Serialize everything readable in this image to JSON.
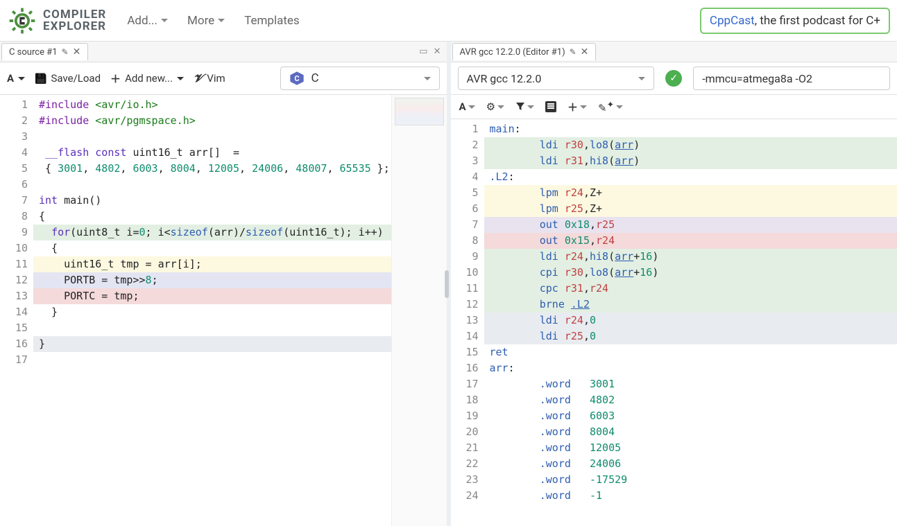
{
  "brand": {
    "line1": "COMPILER",
    "line2": "EXPLORER"
  },
  "topmenu": {
    "add": "Add...",
    "more": "More",
    "templates": "Templates"
  },
  "sponsor": {
    "link_text": "CppCast",
    "rest": ", the first podcast for C+"
  },
  "left": {
    "tab": {
      "title": "C source #1"
    },
    "toolbar": {
      "save": "Save/Load",
      "addnew": "Add new...",
      "vim": "Vim"
    },
    "language": "C",
    "code": [
      {
        "n": 1,
        "hl": "none",
        "tokens": [
          [
            "pre",
            "#include"
          ],
          [
            "id",
            " "
          ],
          [
            "str",
            "<avr/io.h>"
          ]
        ]
      },
      {
        "n": 2,
        "hl": "none",
        "tokens": [
          [
            "pre",
            "#include"
          ],
          [
            "id",
            " "
          ],
          [
            "str",
            "<avr/pgmspace.h>"
          ]
        ]
      },
      {
        "n": 3,
        "hl": "none",
        "tokens": []
      },
      {
        "n": 4,
        "hl": "none",
        "tokens": [
          [
            "id",
            " "
          ],
          [
            "kw",
            "__flash"
          ],
          [
            "id",
            " "
          ],
          [
            "kw",
            "const"
          ],
          [
            "id",
            " uint16_t arr[]  ="
          ]
        ]
      },
      {
        "n": 5,
        "hl": "none",
        "tokens": [
          [
            "id",
            " { "
          ],
          [
            "num",
            "3001"
          ],
          [
            "id",
            ", "
          ],
          [
            "num",
            "4802"
          ],
          [
            "id",
            ", "
          ],
          [
            "num",
            "6003"
          ],
          [
            "id",
            ", "
          ],
          [
            "num",
            "8004"
          ],
          [
            "id",
            ", "
          ],
          [
            "num",
            "12005"
          ],
          [
            "id",
            ", "
          ],
          [
            "num",
            "24006"
          ],
          [
            "id",
            ", "
          ],
          [
            "num",
            "48007"
          ],
          [
            "id",
            ", "
          ],
          [
            "num",
            "65535"
          ],
          [
            "id",
            " };"
          ]
        ]
      },
      {
        "n": 6,
        "hl": "none",
        "tokens": []
      },
      {
        "n": 7,
        "hl": "none",
        "tokens": [
          [
            "kw",
            "int"
          ],
          [
            "id",
            " main()"
          ]
        ]
      },
      {
        "n": 8,
        "hl": "none",
        "tokens": [
          [
            "id",
            "{"
          ]
        ]
      },
      {
        "n": 9,
        "hl": "green",
        "tokens": [
          [
            "id",
            "  "
          ],
          [
            "kw",
            "for"
          ],
          [
            "id",
            "(uint8_t i="
          ],
          [
            "num",
            "0"
          ],
          [
            "id",
            "; i<"
          ],
          [
            "kw2",
            "sizeof"
          ],
          [
            "id",
            "(arr)/"
          ],
          [
            "kw2",
            "sizeof"
          ],
          [
            "id",
            "(uint16_t); i++)"
          ]
        ]
      },
      {
        "n": 10,
        "hl": "none",
        "tokens": [
          [
            "id",
            "  {"
          ]
        ]
      },
      {
        "n": 11,
        "hl": "yellow",
        "tokens": [
          [
            "id",
            "    uint16_t tmp = arr[i];"
          ]
        ]
      },
      {
        "n": 12,
        "hl": "blue",
        "tokens": [
          [
            "id",
            "    PORTB = tmp>>"
          ],
          [
            "num",
            "8"
          ],
          [
            "id",
            ";"
          ]
        ]
      },
      {
        "n": 13,
        "hl": "red",
        "tokens": [
          [
            "id",
            "    PORTC = tmp;"
          ]
        ]
      },
      {
        "n": 14,
        "hl": "none",
        "tokens": [
          [
            "id",
            "  }"
          ]
        ]
      },
      {
        "n": 15,
        "hl": "none",
        "tokens": []
      },
      {
        "n": 16,
        "hl": "gray",
        "tokens": [
          [
            "id",
            "}"
          ]
        ]
      },
      {
        "n": 17,
        "hl": "none",
        "tokens": []
      }
    ]
  },
  "right": {
    "tab": {
      "title": "AVR gcc 12.2.0 (Editor #1)"
    },
    "compiler": "AVR gcc 12.2.0",
    "flags": "-mmcu=atmega8a -O2",
    "asm": [
      {
        "n": 1,
        "hl": "none",
        "tokens": [
          [
            "label",
            "main"
          ],
          [
            "id",
            ":"
          ]
        ]
      },
      {
        "n": 2,
        "hl": "green",
        "tokens": [
          [
            "id",
            "        "
          ],
          [
            "asm",
            "ldi "
          ],
          [
            "str2",
            "r30"
          ],
          [
            "id",
            ","
          ],
          [
            "asm",
            "lo8"
          ],
          [
            "id",
            "("
          ],
          [
            "link",
            "arr"
          ],
          [
            "id",
            ")"
          ]
        ]
      },
      {
        "n": 3,
        "hl": "green",
        "tokens": [
          [
            "id",
            "        "
          ],
          [
            "asm",
            "ldi "
          ],
          [
            "str2",
            "r31"
          ],
          [
            "id",
            ","
          ],
          [
            "asm",
            "hi8"
          ],
          [
            "id",
            "("
          ],
          [
            "link",
            "arr"
          ],
          [
            "id",
            ")"
          ]
        ]
      },
      {
        "n": 4,
        "hl": "none",
        "tokens": [
          [
            "label",
            ".L2"
          ],
          [
            "id",
            ":"
          ]
        ]
      },
      {
        "n": 5,
        "hl": "yellow",
        "tokens": [
          [
            "id",
            "        "
          ],
          [
            "asm",
            "lpm "
          ],
          [
            "str2",
            "r24"
          ],
          [
            "id",
            ",Z+"
          ]
        ]
      },
      {
        "n": 6,
        "hl": "yellow",
        "tokens": [
          [
            "id",
            "        "
          ],
          [
            "asm",
            "lpm "
          ],
          [
            "str2",
            "r25"
          ],
          [
            "id",
            ",Z+"
          ]
        ]
      },
      {
        "n": 7,
        "hl": "purple",
        "tokens": [
          [
            "id",
            "        "
          ],
          [
            "asm",
            "out "
          ],
          [
            "num",
            "0x18"
          ],
          [
            "id",
            ","
          ],
          [
            "str2",
            "r25"
          ]
        ]
      },
      {
        "n": 8,
        "hl": "red",
        "tokens": [
          [
            "id",
            "        "
          ],
          [
            "asm",
            "out "
          ],
          [
            "num",
            "0x15"
          ],
          [
            "id",
            ","
          ],
          [
            "str2",
            "r24"
          ]
        ]
      },
      {
        "n": 9,
        "hl": "green",
        "tokens": [
          [
            "id",
            "        "
          ],
          [
            "asm",
            "ldi "
          ],
          [
            "str2",
            "r24"
          ],
          [
            "id",
            ","
          ],
          [
            "asm",
            "hi8"
          ],
          [
            "id",
            "("
          ],
          [
            "link",
            "arr"
          ],
          [
            "id",
            "+"
          ],
          [
            "num",
            "16"
          ],
          [
            "id",
            ")"
          ]
        ]
      },
      {
        "n": 10,
        "hl": "green",
        "tokens": [
          [
            "id",
            "        "
          ],
          [
            "asm",
            "cpi "
          ],
          [
            "str2",
            "r30"
          ],
          [
            "id",
            ","
          ],
          [
            "asm",
            "lo8"
          ],
          [
            "id",
            "("
          ],
          [
            "link",
            "arr"
          ],
          [
            "id",
            "+"
          ],
          [
            "num",
            "16"
          ],
          [
            "id",
            ")"
          ]
        ]
      },
      {
        "n": 11,
        "hl": "green",
        "tokens": [
          [
            "id",
            "        "
          ],
          [
            "asm",
            "cpc "
          ],
          [
            "str2",
            "r31"
          ],
          [
            "id",
            ","
          ],
          [
            "str2",
            "r24"
          ]
        ]
      },
      {
        "n": 12,
        "hl": "green",
        "tokens": [
          [
            "id",
            "        "
          ],
          [
            "asm",
            "brne "
          ],
          [
            "link",
            ".L2"
          ]
        ]
      },
      {
        "n": 13,
        "hl": "gray",
        "tokens": [
          [
            "id",
            "        "
          ],
          [
            "asm",
            "ldi "
          ],
          [
            "str2",
            "r24"
          ],
          [
            "id",
            ","
          ],
          [
            "num",
            "0"
          ]
        ]
      },
      {
        "n": 14,
        "hl": "gray",
        "tokens": [
          [
            "id",
            "        "
          ],
          [
            "asm",
            "ldi "
          ],
          [
            "str2",
            "r25"
          ],
          [
            "id",
            ","
          ],
          [
            "num",
            "0"
          ]
        ]
      },
      {
        "n": 15,
        "hl": "none",
        "tokens": [
          [
            "asm",
            "ret"
          ]
        ]
      },
      {
        "n": 16,
        "hl": "none",
        "tokens": [
          [
            "label",
            "arr"
          ],
          [
            "id",
            ":"
          ]
        ]
      },
      {
        "n": 17,
        "hl": "none",
        "tokens": [
          [
            "id",
            "        "
          ],
          [
            "asm",
            ".word"
          ],
          [
            "id",
            "   "
          ],
          [
            "num",
            "3001"
          ]
        ]
      },
      {
        "n": 18,
        "hl": "none",
        "tokens": [
          [
            "id",
            "        "
          ],
          [
            "asm",
            ".word"
          ],
          [
            "id",
            "   "
          ],
          [
            "num",
            "4802"
          ]
        ]
      },
      {
        "n": 19,
        "hl": "none",
        "tokens": [
          [
            "id",
            "        "
          ],
          [
            "asm",
            ".word"
          ],
          [
            "id",
            "   "
          ],
          [
            "num",
            "6003"
          ]
        ]
      },
      {
        "n": 20,
        "hl": "none",
        "tokens": [
          [
            "id",
            "        "
          ],
          [
            "asm",
            ".word"
          ],
          [
            "id",
            "   "
          ],
          [
            "num",
            "8004"
          ]
        ]
      },
      {
        "n": 21,
        "hl": "none",
        "tokens": [
          [
            "id",
            "        "
          ],
          [
            "asm",
            ".word"
          ],
          [
            "id",
            "   "
          ],
          [
            "num",
            "12005"
          ]
        ]
      },
      {
        "n": 22,
        "hl": "none",
        "tokens": [
          [
            "id",
            "        "
          ],
          [
            "asm",
            ".word"
          ],
          [
            "id",
            "   "
          ],
          [
            "num",
            "24006"
          ]
        ]
      },
      {
        "n": 23,
        "hl": "none",
        "tokens": [
          [
            "id",
            "        "
          ],
          [
            "asm",
            ".word"
          ],
          [
            "id",
            "   "
          ],
          [
            "num",
            "-17529"
          ]
        ]
      },
      {
        "n": 24,
        "hl": "none",
        "tokens": [
          [
            "id",
            "        "
          ],
          [
            "asm",
            ".word"
          ],
          [
            "id",
            "   "
          ],
          [
            "num",
            "-1"
          ]
        ]
      }
    ]
  }
}
